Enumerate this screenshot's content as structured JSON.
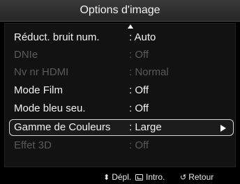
{
  "header": {
    "title": "Options d'image"
  },
  "menu": {
    "items": [
      {
        "label": "Réduct. bruit num.",
        "value": ": Auto",
        "state": "enabled"
      },
      {
        "label": "DNIe",
        "value": ": Off",
        "state": "disabled"
      },
      {
        "label": "Nv nr HDMI",
        "value": ": Normal",
        "state": "disabled"
      },
      {
        "label": "Mode Film",
        "value": ": Off",
        "state": "enabled"
      },
      {
        "label": "Mode bleu seu.",
        "value": ": Off",
        "state": "enabled"
      },
      {
        "label": "Gamme de Couleurs",
        "value": ": Large",
        "state": "selected"
      },
      {
        "label": "Effet 3D",
        "value": ": Off",
        "state": "disabled"
      }
    ]
  },
  "footer": {
    "move_label": "Dépl.",
    "move_icon": "updown-arrows-icon",
    "enter_label": "Intro.",
    "enter_icon": "enter-icon",
    "return_label": "Retour",
    "return_icon": "return-icon"
  },
  "colors": {
    "background": "#000000",
    "panel": "#121212",
    "title_bar": "#2e2e2e",
    "enabled_text": "#f4f4f4",
    "disabled_text": "#5a5a5a",
    "selection_border": "#d8d8d8"
  }
}
